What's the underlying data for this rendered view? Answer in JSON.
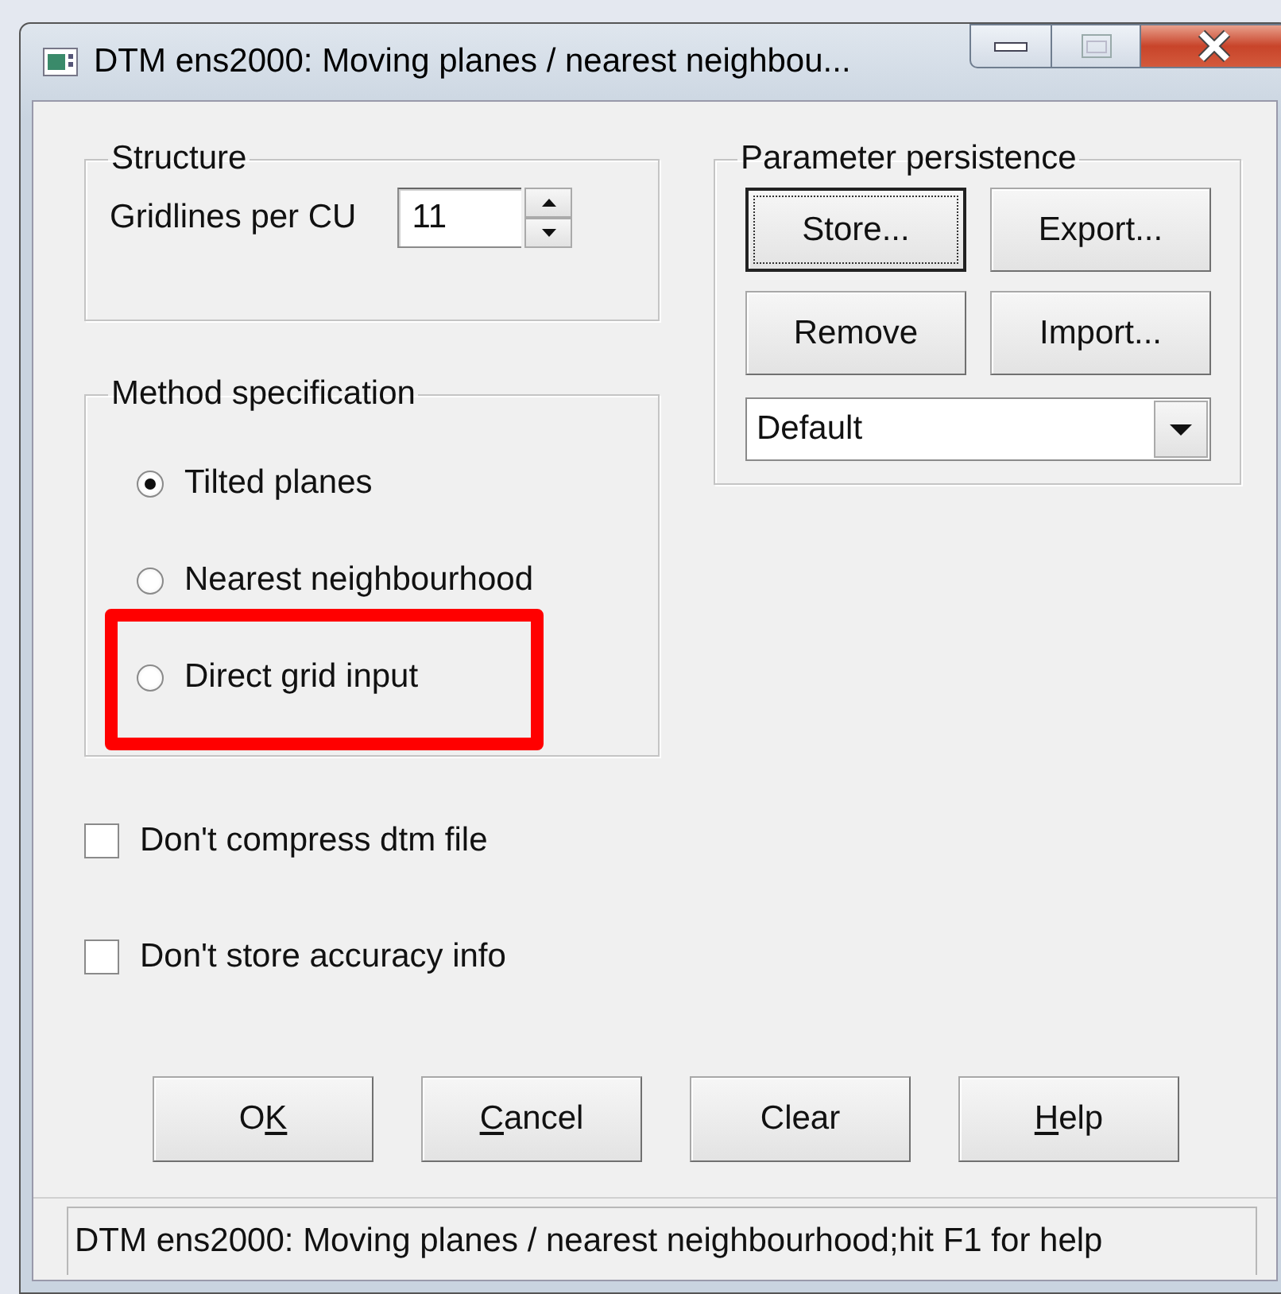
{
  "window": {
    "title": "DTM ens2000: Moving planes / nearest neighbou..."
  },
  "structure": {
    "title": "Structure",
    "label": "Gridlines per CU",
    "value": "11"
  },
  "method": {
    "title": "Method specification",
    "options": [
      {
        "label": "Tilted planes",
        "selected": true,
        "highlighted": false
      },
      {
        "label": "Nearest neighbourhood",
        "selected": false,
        "highlighted": false
      },
      {
        "label": "Direct grid input",
        "selected": false,
        "highlighted": true
      }
    ]
  },
  "persistence": {
    "title": "Parameter persistence",
    "buttons": [
      {
        "label": "Store...",
        "focused": true
      },
      {
        "label": "Export...",
        "focused": false
      },
      {
        "label": "Remove",
        "focused": false
      },
      {
        "label": "Import...",
        "focused": false
      }
    ],
    "selection": "Default"
  },
  "options": [
    {
      "label": "Don't compress dtm file",
      "checked": false
    },
    {
      "label": "Don't store accuracy info",
      "checked": false
    }
  ],
  "buttons": [
    {
      "label_start": "O",
      "access_key": "K"
    },
    {
      "access_key": "C",
      "label_end": "ancel"
    },
    {
      "label_start": "Clear"
    },
    {
      "access_key": "H",
      "label_end": "elp"
    }
  ],
  "status_bar": "DTM ens2000: Moving planes / nearest neighbourhood;hit F1 for help"
}
